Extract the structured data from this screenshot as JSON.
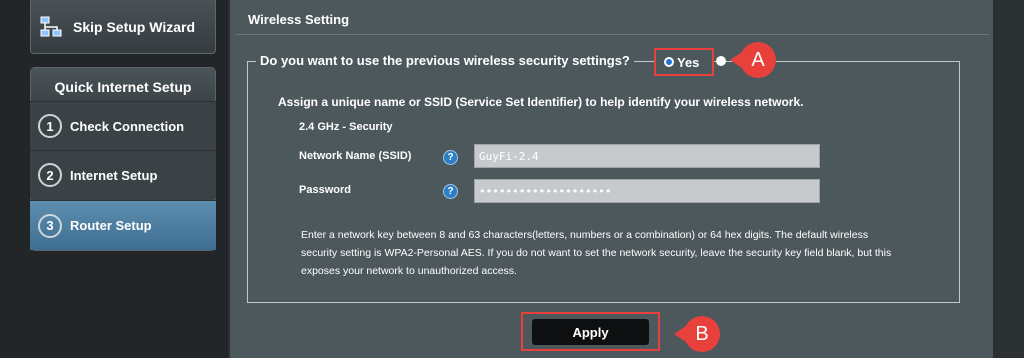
{
  "sidebar": {
    "skip_wizard": "Skip Setup Wizard",
    "qis_title": "Quick Internet Setup",
    "steps": [
      {
        "num": "1",
        "label": "Check Connection"
      },
      {
        "num": "2",
        "label": "Internet Setup"
      },
      {
        "num": "3",
        "label": "Router Setup"
      }
    ]
  },
  "main": {
    "title": "Wireless Setting",
    "question": "Do you want to use the previous wireless security settings?",
    "yes_label": "Yes",
    "assign_text": "Assign a unique name or SSID (Service Set Identifier) to help identify your wireless network.",
    "band_title": "2.4 GHz - Security",
    "ssid_label": "Network Name (SSID)",
    "ssid_value": "GuyFi-2.4",
    "password_label": "Password",
    "password_value": "••••••••••••••••••••",
    "help_icon_text": "?",
    "info_text": "Enter a network key between 8 and 63 characters(letters, numbers or a combination) or 64 hex digits. The default wireless security setting is WPA2-Personal AES. If you do not want to set the network security, leave the security key field blank, but this exposes your network to unauthorized access.",
    "apply_label": "Apply"
  },
  "annotations": {
    "a": "A",
    "b": "B"
  },
  "colors": {
    "accent_red": "#e8413c",
    "panel": "#4d585d",
    "selected_step": "#3d6e91"
  }
}
